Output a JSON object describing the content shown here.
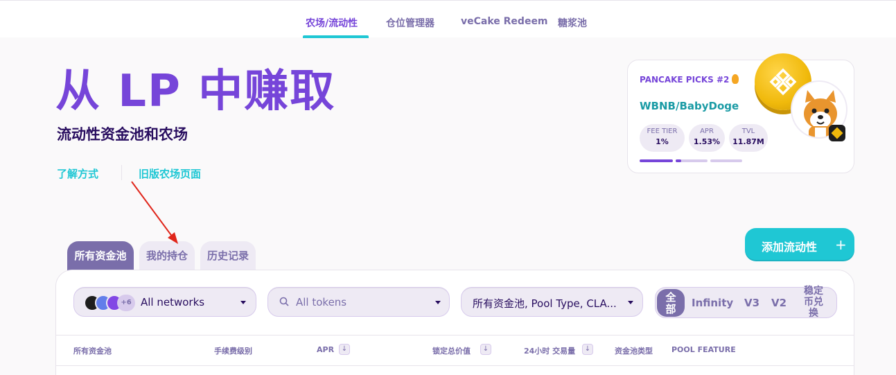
{
  "subnav": {
    "items": [
      {
        "label": "农场/流动性",
        "active": true
      },
      {
        "label": "仓位管理器"
      },
      {
        "label": "veCake Redeem"
      },
      {
        "label": "糖浆池"
      }
    ]
  },
  "hero": {
    "title": "从 LP 中赚取",
    "subtitle": "流动性资金池和农场",
    "links": [
      "了解方式",
      "旧版农场页面"
    ]
  },
  "picks": {
    "title": "PANCAKE PICKS #2",
    "pair": "WBNB/BabyDoge",
    "stats": [
      {
        "label": "FEE TIER",
        "value": "1%"
      },
      {
        "label": "APR",
        "value": "1.53%"
      },
      {
        "label": "TVL",
        "value": "11.87M"
      }
    ],
    "carousel_position": 1,
    "carousel_count": 3
  },
  "add_liquidity": {
    "label": "添加流动性",
    "icon": "plus-icon"
  },
  "tabs": [
    {
      "label": "所有资金池",
      "active": true
    },
    {
      "label": "我的持仓"
    },
    {
      "label": "历史记录"
    }
  ],
  "filters": {
    "networks": {
      "more_count": "+6",
      "label": "All networks"
    },
    "tokens": {
      "placeholder": "All tokens"
    },
    "pool_type": {
      "label": "所有资金池, Pool Type, CLA..."
    },
    "versions": [
      "全部",
      "Infinity",
      "V3",
      "V2",
      "稳定币兑换"
    ],
    "active_version": "全部"
  },
  "table": {
    "headers": [
      "所有资金池",
      "手续费级别",
      "APR",
      "锁定总价值",
      "24小时 交易量",
      "资金池类型",
      "POOL FEATURE"
    ]
  },
  "colors": {
    "primary": "#7645d9",
    "secondary": "#1fc7d4",
    "text": "#280d5f",
    "text_subtle": "#7a6eaa",
    "annotation_arrow": "#e0261b"
  }
}
